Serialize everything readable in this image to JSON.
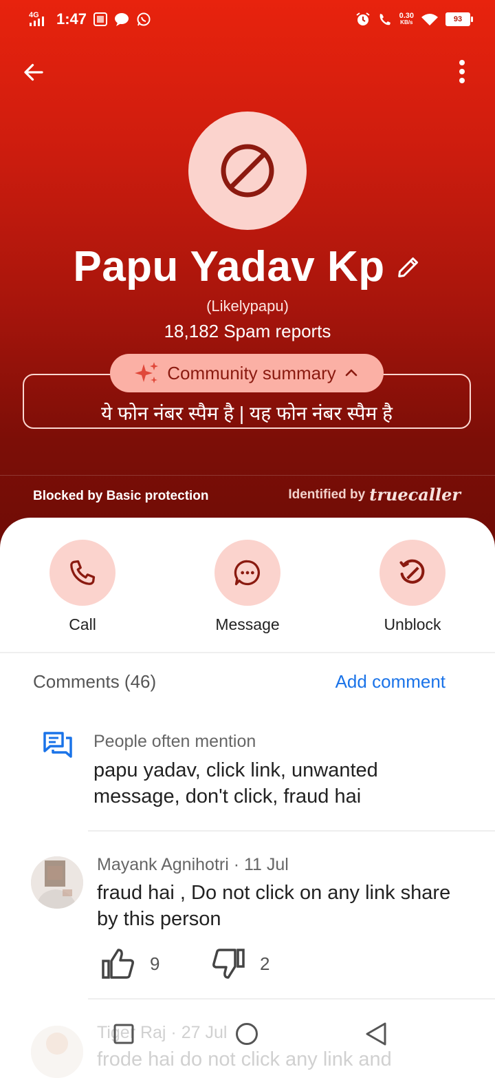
{
  "status_bar": {
    "network": "4G",
    "time": "1:47",
    "speed_value": "0.30",
    "speed_unit": "KB/s",
    "battery": "93"
  },
  "header": {
    "back_icon": "arrow-left-icon",
    "menu_icon": "more-vertical-icon"
  },
  "contact": {
    "avatar_icon": "blocked-icon",
    "name": "Papu Yadav Kp",
    "alt_name": "(Likelypapu)",
    "spam_reports": "18,182 Spam reports"
  },
  "community_summary": {
    "label": "Community summary",
    "text": "ये फोन नंबर स्पैम है | यह फोन नंबर स्पैम है"
  },
  "footer_info": {
    "blocked_by": "Blocked by Basic protection",
    "identified_by": "Identified by",
    "brand": "truecaller"
  },
  "actions": [
    {
      "label": "Call",
      "icon": "phone-icon"
    },
    {
      "label": "Message",
      "icon": "message-icon"
    },
    {
      "label": "Unblock",
      "icon": "unblock-icon"
    }
  ],
  "comments": {
    "title": "Comments (46)",
    "add_label": "Add comment",
    "mentions_label": "People often mention",
    "mentions_text": "papu yadav, click link, unwanted message, don't click, fraud hai",
    "items": [
      {
        "author_meta": "Mayank Agnihotri · 11 Jul",
        "text": "fraud hai , Do not click on any link share by this person",
        "likes": "9",
        "dislikes": "2"
      },
      {
        "author_meta": "Tiger Raj · 27 Jul",
        "text": "frode hai do not click any link and"
      }
    ]
  },
  "colors": {
    "hero_top": "#e8230d",
    "hero_bottom": "#6f0c06",
    "accent_pink": "#fbd3cd",
    "link_blue": "#1a73e8",
    "icon_dark_red": "#8a1a10"
  }
}
